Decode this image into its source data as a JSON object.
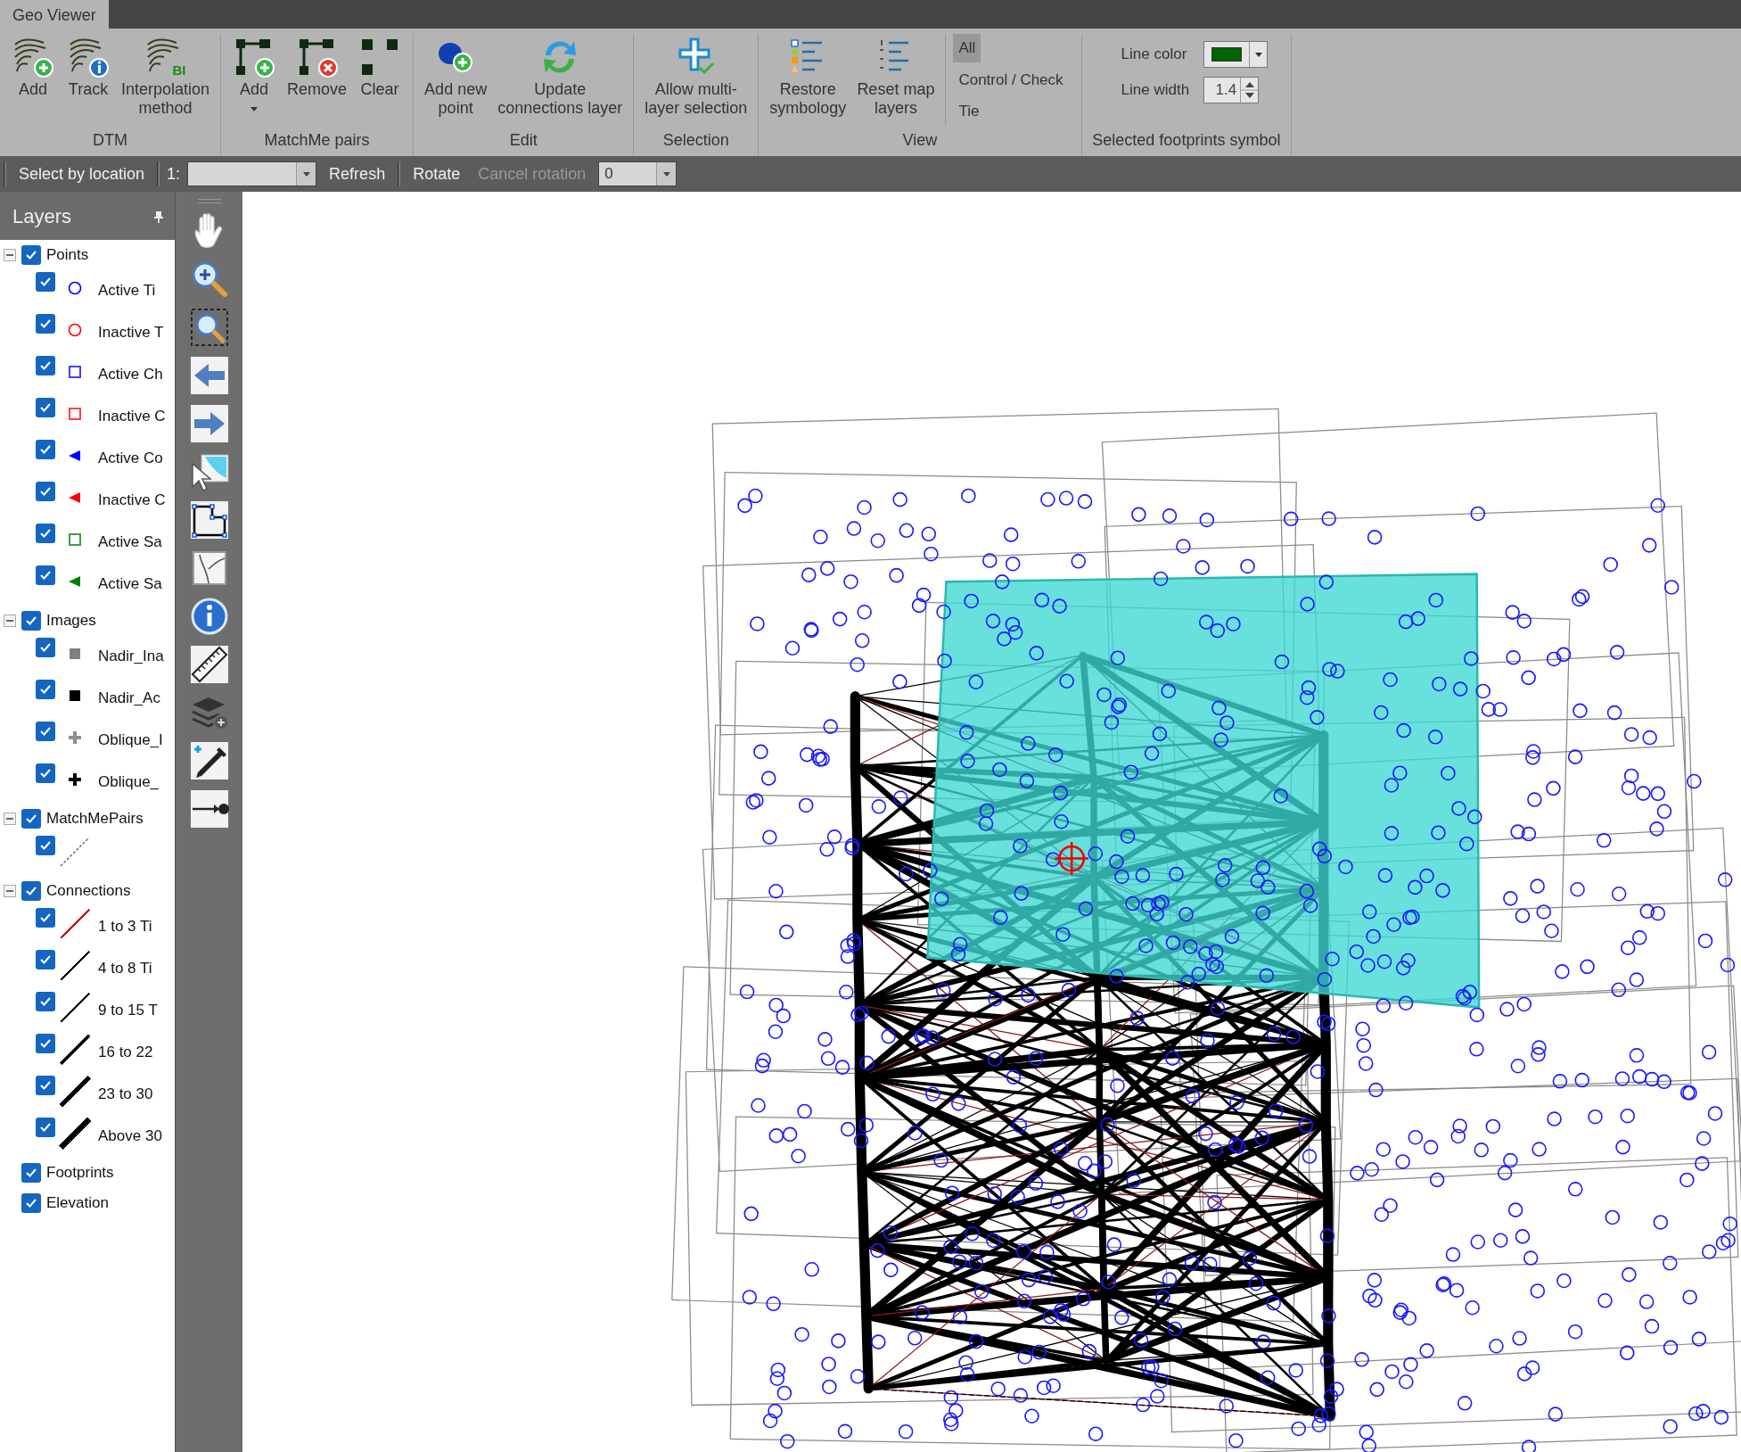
{
  "window": {
    "title": "Geo Viewer"
  },
  "ribbon": {
    "groups": [
      {
        "label": "DTM",
        "buttons": [
          {
            "label": "Add"
          },
          {
            "label": "Track"
          },
          {
            "label": "Interpolation\nmethod",
            "badge": "BI"
          }
        ]
      },
      {
        "label": "MatchMe pairs",
        "buttons": [
          {
            "label": "Add",
            "menu": true
          },
          {
            "label": "Remove"
          },
          {
            "label": "Clear"
          }
        ]
      },
      {
        "label": "Edit",
        "buttons": [
          {
            "label": "Add new\npoint"
          },
          {
            "label": "Update\nconnections layer"
          }
        ]
      },
      {
        "label": "Selection",
        "buttons": [
          {
            "label": "Allow multi-\nlayer selection"
          }
        ]
      },
      {
        "label": "View",
        "buttons": [
          {
            "label": "Restore\nsymbology"
          },
          {
            "label": "Reset map\nlayers"
          }
        ],
        "filters": [
          {
            "label": "All",
            "selected": true
          },
          {
            "label": "Control / Check",
            "selected": false
          },
          {
            "label": "Tie",
            "selected": false
          }
        ]
      },
      {
        "label": "Selected footprints symbol",
        "line_color": {
          "label": "Line color",
          "color": "#006400"
        },
        "line_width": {
          "label": "Line width",
          "value": "1.4"
        }
      }
    ]
  },
  "toolbar": {
    "select_by_location": "Select by location",
    "scale_label": "1:",
    "refresh": "Refresh",
    "rotate": "Rotate",
    "cancel_rotation": {
      "label": "Cancel rotation",
      "disabled": true
    },
    "rotation_value": "0"
  },
  "layers": {
    "title": "Layers",
    "tree": [
      {
        "label": "Points",
        "checked": true,
        "expanded": true,
        "children": [
          {
            "label": "Active Ti",
            "checked": true,
            "kind": "circle",
            "color": "#0000ff"
          },
          {
            "label": "Inactive T",
            "checked": true,
            "kind": "circle",
            "color": "#ff0000"
          },
          {
            "label": "Active Ch",
            "checked": true,
            "kind": "square",
            "color": "#4040ff"
          },
          {
            "label": "Inactive C",
            "checked": true,
            "kind": "square",
            "color": "#ff4040"
          },
          {
            "label": "Active Co",
            "checked": true,
            "kind": "triangle",
            "color": "#0000ff"
          },
          {
            "label": "Inactive C",
            "checked": true,
            "kind": "triangle",
            "color": "#ff0000"
          },
          {
            "label": "Active Sa",
            "checked": true,
            "kind": "square",
            "color": "#40a040"
          },
          {
            "label": "Active Sa",
            "checked": true,
            "kind": "triangle",
            "color": "#008000"
          }
        ]
      },
      {
        "label": "Images",
        "checked": true,
        "expanded": true,
        "children": [
          {
            "label": "Nadir_Ina",
            "checked": true,
            "kind": "block",
            "color": "#808080"
          },
          {
            "label": "Nadir_Ac",
            "checked": true,
            "kind": "block",
            "color": "#000000"
          },
          {
            "label": "Oblique_I",
            "checked": true,
            "kind": "cross",
            "color": "#909090"
          },
          {
            "label": "Oblique_",
            "checked": true,
            "kind": "cross",
            "color": "#000000"
          }
        ]
      },
      {
        "label": "MatchMePairs",
        "checked": true,
        "expanded": true,
        "children": [
          {
            "checked": true,
            "kind": "dashed-line"
          }
        ]
      },
      {
        "label": "Connections",
        "checked": true,
        "expanded": true,
        "children": [
          {
            "label": "1 to 3  Ti",
            "checked": true,
            "kind": "line",
            "color": "#c00000"
          },
          {
            "label": "4 to 8  Ti",
            "checked": true,
            "kind": "line",
            "color": "#000000"
          },
          {
            "label": "9 to 15  T",
            "checked": true,
            "kind": "line",
            "color": "#000000"
          },
          {
            "label": "16 to 22",
            "checked": true,
            "kind": "line",
            "color": "#000000"
          },
          {
            "label": "23 to 30",
            "checked": true,
            "kind": "line",
            "color": "#000000"
          },
          {
            "label": "Above 30",
            "checked": true,
            "kind": "line",
            "color": "#000000"
          }
        ]
      },
      {
        "label": "Footprints",
        "checked": true
      },
      {
        "label": "Elevation",
        "checked": true
      }
    ]
  }
}
